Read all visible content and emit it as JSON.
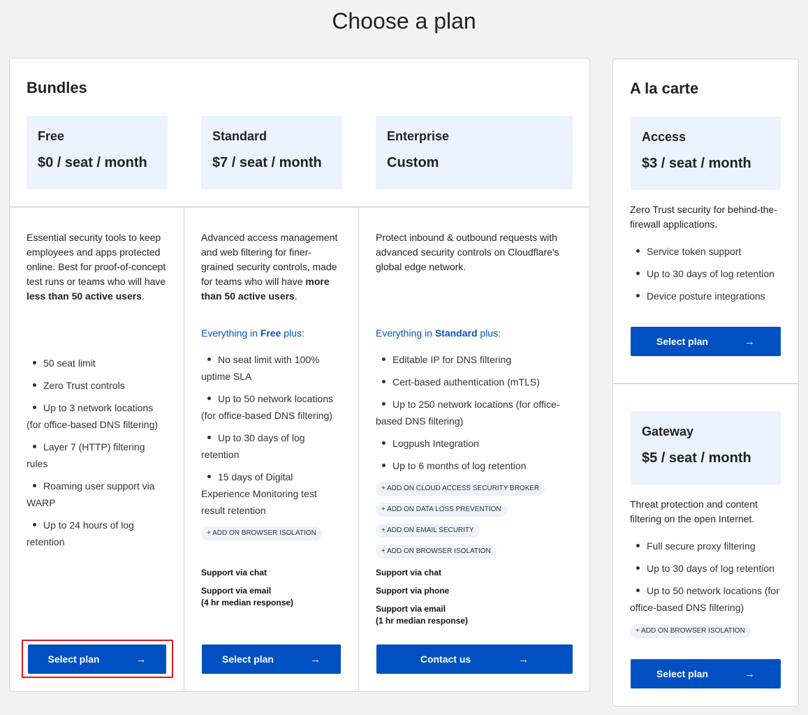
{
  "page_title": "Choose a plan",
  "bundles": {
    "heading": "Bundles",
    "plans": [
      {
        "tier": "Free",
        "price": "$0 / seat / month",
        "desc_parts": [
          "Essential security tools to keep employees and apps protected online. Best for proof-of-concept test runs or teams who will have ",
          "less than 50 active users",
          "."
        ],
        "features": [
          "50 seat limit",
          "Zero Trust controls",
          "Up to 3 network locations (for office-based DNS filtering)",
          "Layer 7 (HTTP) filtering rules",
          "Roaming user support via WARP",
          "Up to 24 hours of log retention"
        ],
        "button_label": "Select plan"
      },
      {
        "tier": "Standard",
        "price": "$7 / seat / month",
        "desc_parts": [
          "Advanced access management and web filtering for finer-grained security controls, made for teams who will have ",
          "more than 50 active users",
          "."
        ],
        "plus_prefix": "Everything in ",
        "plus_name": "Free",
        "plus_suffix": " plus:",
        "features": [
          "No seat limit with 100% uptime SLA",
          "Up to 50 network locations (for office-based DNS filtering)",
          "Up to 30 days of log retention",
          "15 days of Digital Experience Monitoring test result retention"
        ],
        "addons": [
          "+ ADD ON BROWSER ISOLATION"
        ],
        "support": [
          "Support via chat",
          "Support via email",
          "(4 hr median response)"
        ],
        "button_label": "Select plan"
      },
      {
        "tier": "Enterprise",
        "price": "Custom",
        "desc": "Protect inbound & outbound requests with advanced security controls on Cloudflare's global edge network.",
        "plus_prefix": "Everything in ",
        "plus_name": "Standard",
        "plus_suffix": " plus:",
        "features": [
          "Editable IP for DNS filtering",
          "Cert-based authentication (mTLS)",
          "Up to 250 network locations (for office-based DNS filtering)",
          "Logpush Integration",
          "Up to 6 months of log retention"
        ],
        "addons": [
          "+ ADD ON CLOUD ACCESS SECURITY BROKER",
          "+ ADD ON DATA LOSS PREVENTION",
          "+ ADD ON EMAIL SECURITY",
          "+ ADD ON BROWSER ISOLATION"
        ],
        "support": [
          "Support via chat",
          "Support via phone",
          "Support via email",
          "(1 hr median response)"
        ],
        "button_label": "Contact us"
      }
    ]
  },
  "carte": {
    "heading": "A la carte",
    "plans": [
      {
        "tier": "Access",
        "price": "$3 / seat / month",
        "desc": "Zero Trust security for behind-the-firewall applications.",
        "features": [
          "Service token support",
          "Up to 30 days of log retention",
          "Device posture integrations"
        ],
        "button_label": "Select plan"
      },
      {
        "tier": "Gateway",
        "price": "$5 / seat / month",
        "desc": "Threat protection and content filtering on the open Internet.",
        "features": [
          "Full secure proxy filtering",
          "Up to 30 days of log retention",
          "Up to 50 network locations (for office-based DNS filtering)"
        ],
        "addons": [
          "+ ADD ON BROWSER ISOLATION"
        ],
        "button_label": "Select plan"
      }
    ]
  },
  "arrow_glyph": "→",
  "colors": {
    "brand_blue": "#0050c2",
    "price_bg": "#ebf3ff",
    "highlight_red": "#e0141e"
  }
}
